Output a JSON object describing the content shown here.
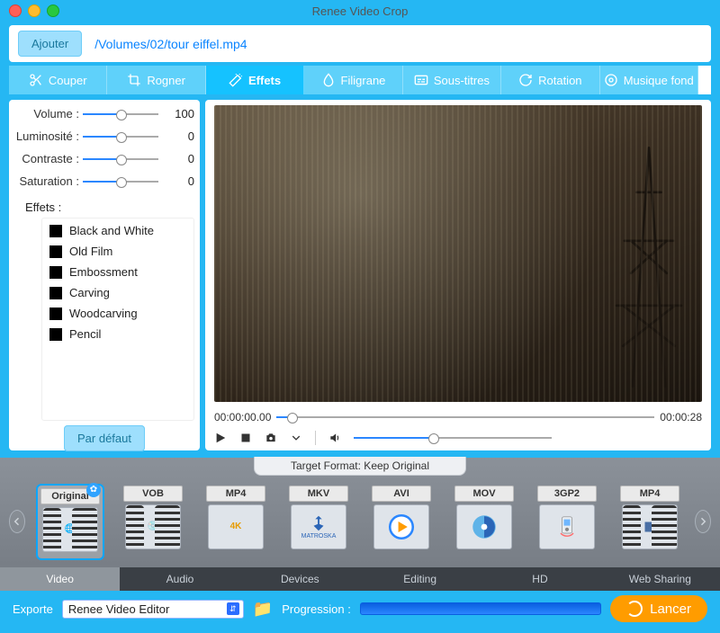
{
  "window": {
    "title": "Renee Video Crop"
  },
  "header": {
    "add_button": "Ajouter",
    "filepath": "/Volumes/02/tour eiffel.mp4"
  },
  "tabs": [
    "Couper",
    "Rogner",
    "Effets",
    "Filigrane",
    "Sous-titres",
    "Rotation",
    "Musique fond"
  ],
  "active_tab_index": 2,
  "adjust": {
    "volume": {
      "label": "Volume :",
      "value": "100",
      "pct": 50
    },
    "brightness": {
      "label": "Luminosité :",
      "value": "0",
      "pct": 50
    },
    "contrast": {
      "label": "Contraste :",
      "value": "0",
      "pct": 50
    },
    "saturation": {
      "label": "Saturation :",
      "value": "0",
      "pct": 50
    }
  },
  "effects_label": "Effets :",
  "effects": [
    "Black and White",
    "Old Film",
    "Embossment",
    "Carving",
    "Woodcarving",
    "Pencil"
  ],
  "default_button": "Par défaut",
  "player": {
    "current_time": "00:00:00.00",
    "duration": "00:00:28",
    "seek_pct": 4,
    "volume_pct": 40
  },
  "format_panel": {
    "title": "Target Format: Keep Original",
    "formats": [
      "Original",
      "VOB",
      "MP4",
      "MKV",
      "AVI",
      "MOV",
      "3GP2",
      "MP4"
    ],
    "format_sub": [
      "",
      "",
      "4K",
      "MATROSKA",
      "",
      "",
      "",
      ""
    ],
    "selected_index": 0,
    "tabs": [
      "Video",
      "Audio",
      "Devices",
      "Editing",
      "HD",
      "Web Sharing"
    ],
    "active_tab_index": 0
  },
  "status": {
    "export_label": "Exporte",
    "export_value": "Renee Video Editor",
    "progress_label": "Progression :",
    "launch_label": "Lancer"
  },
  "colors": {
    "accent": "#25b7f3",
    "launch": "#ff9c00"
  }
}
